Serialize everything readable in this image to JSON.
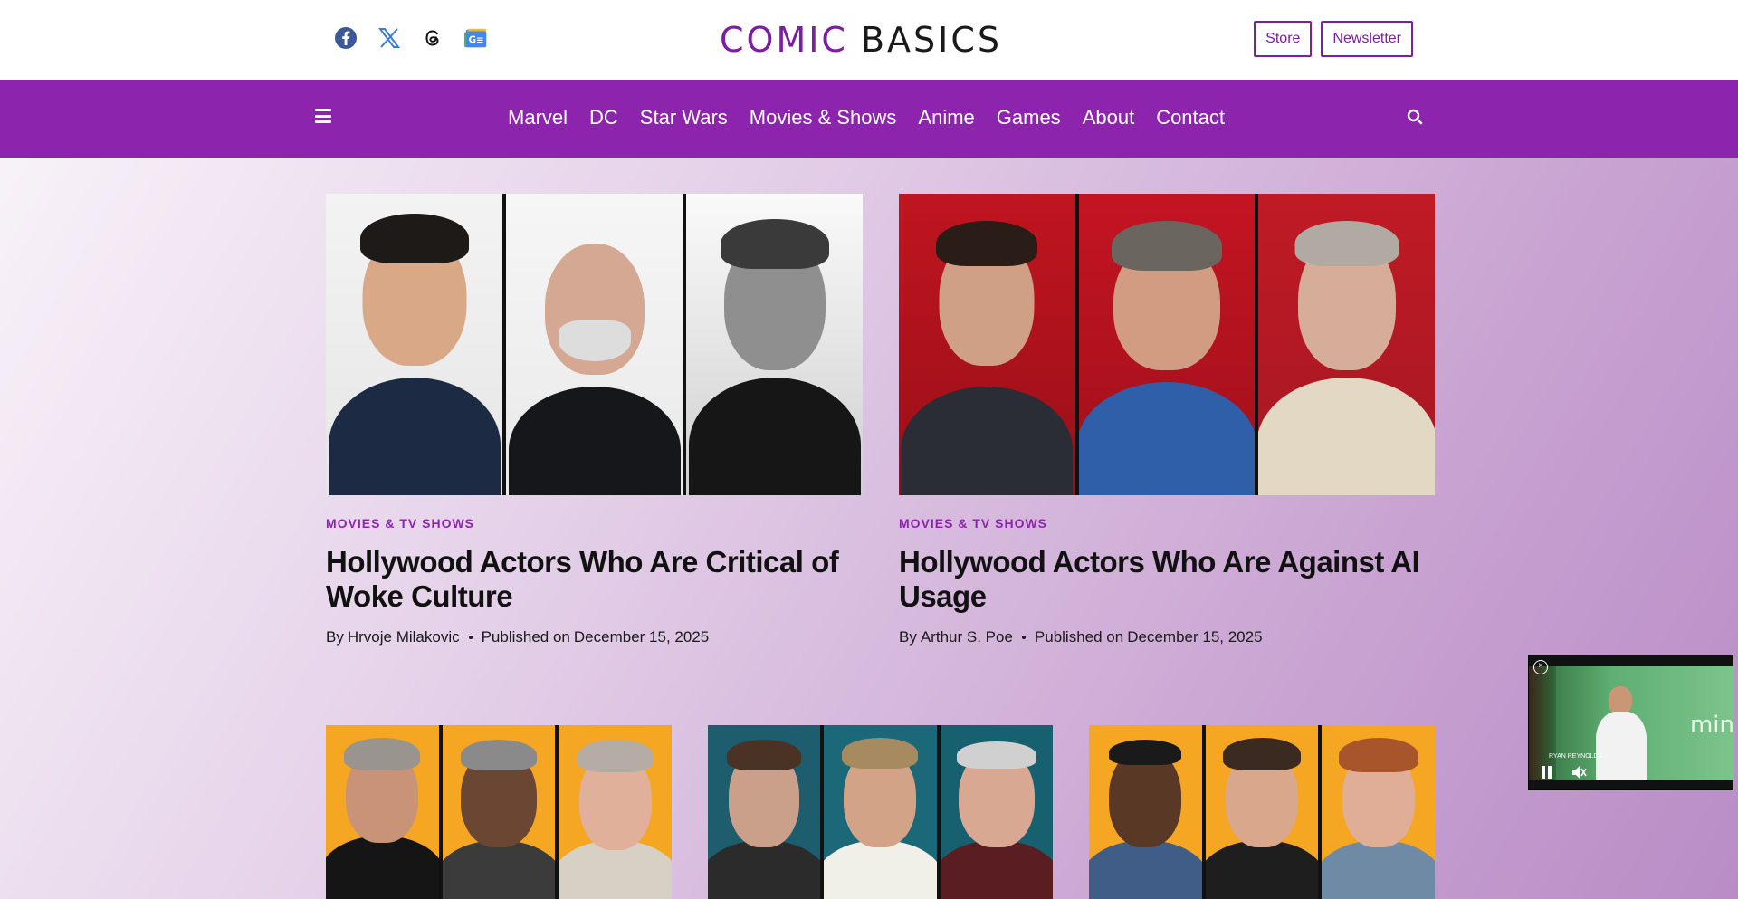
{
  "header": {
    "logo_part1": "COMIC",
    "logo_part2": "BASICS",
    "social_icons": [
      "facebook-icon",
      "x-icon",
      "threads-icon",
      "google-news-icon"
    ],
    "store_label": "Store",
    "newsletter_label": "Newsletter"
  },
  "nav": {
    "items": [
      "Marvel",
      "DC",
      "Star Wars",
      "Movies & Shows",
      "Anime",
      "Games",
      "About",
      "Contact"
    ]
  },
  "articles": [
    {
      "category": "MOVIES & TV SHOWS",
      "title": "Hollywood Actors Who Are Critical of Woke Culture",
      "author_prefix": "By",
      "author": "Hrvoje Milakovic",
      "published_prefix": "Published on",
      "date": "December 15, 2025"
    },
    {
      "category": "MOVIES & TV SHOWS",
      "title": "Hollywood Actors Who Are Against AI Usage",
      "author_prefix": "By",
      "author": "Arthur S. Poe",
      "published_prefix": "Published on",
      "date": "December 15, 2025"
    }
  ],
  "video": {
    "overlay_text": "RYAN REYNOLDS",
    "brand_text": "min"
  },
  "colors": {
    "brand_purple": "#8c24ad",
    "logo_purple": "#7b1fa2"
  }
}
